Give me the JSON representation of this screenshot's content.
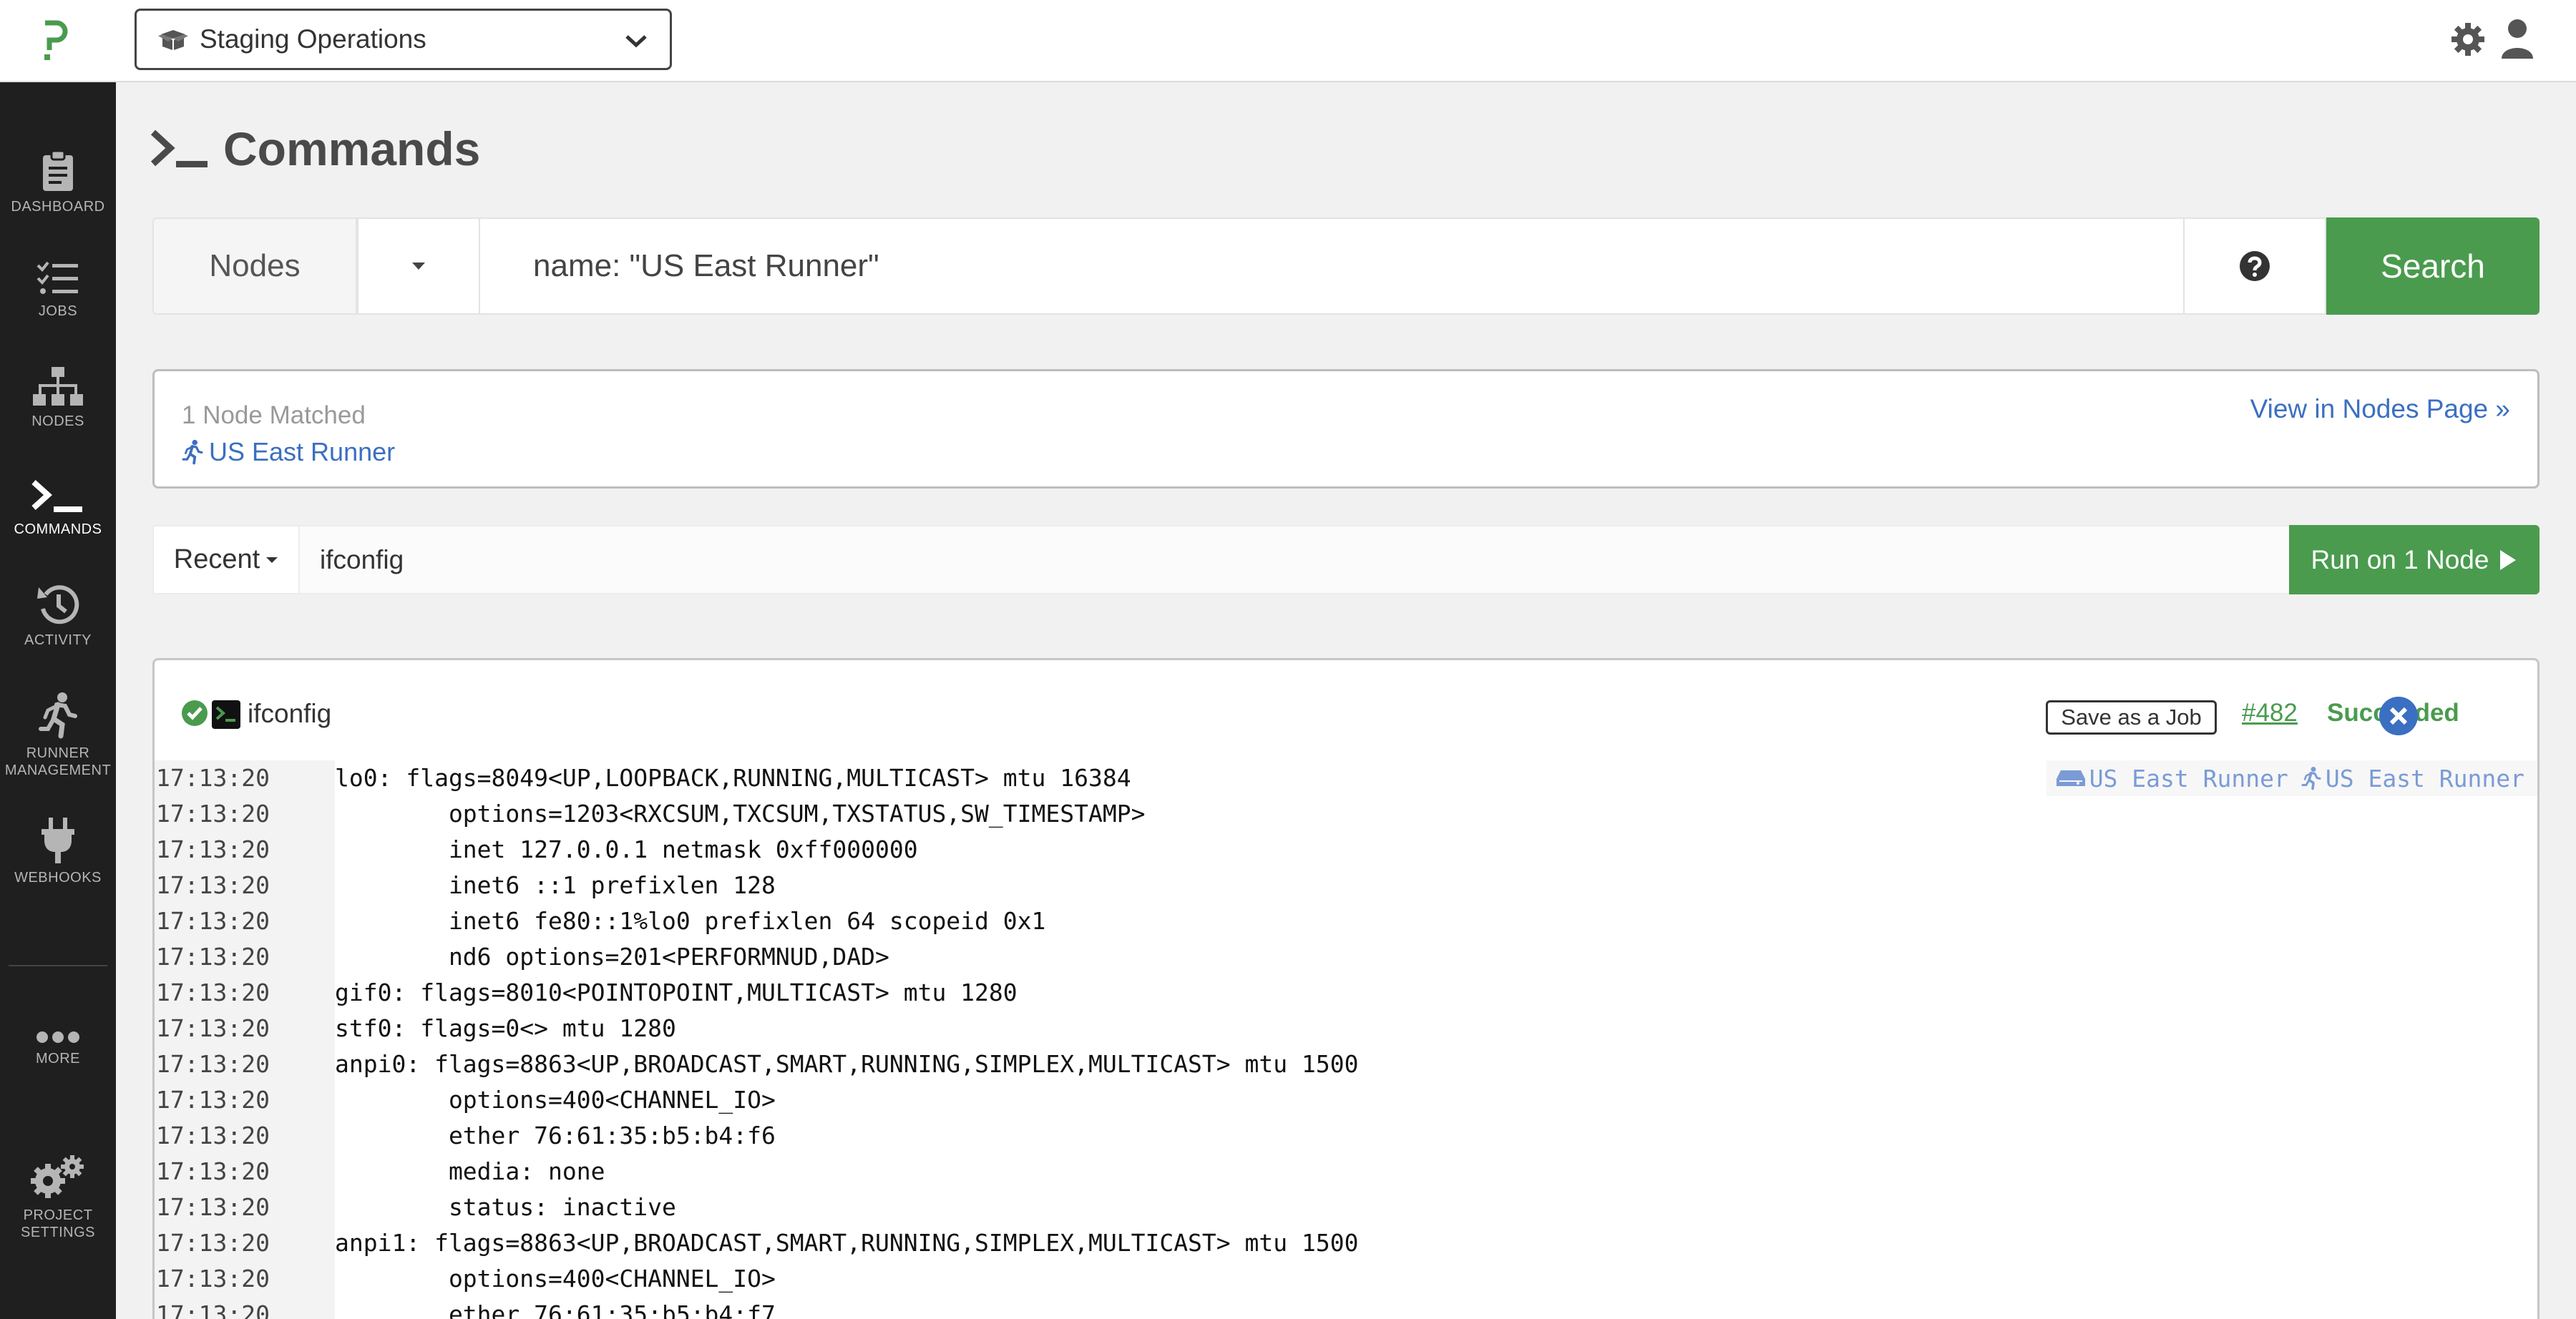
{
  "header": {
    "project_name": "Staging Operations"
  },
  "sidebar": {
    "items": [
      {
        "label": "DASHBOARD",
        "icon": "clipboard-icon"
      },
      {
        "label": "JOBS",
        "icon": "checklist-icon"
      },
      {
        "label": "NODES",
        "icon": "sitemap-icon"
      },
      {
        "label": "COMMANDS",
        "icon": "terminal-icon",
        "active": true
      },
      {
        "label": "ACTIVITY",
        "icon": "history-icon"
      },
      {
        "label": "RUNNER",
        "label2": "MANAGEMENT",
        "icon": "runner-icon"
      },
      {
        "label": "WEBHOOKS",
        "icon": "plug-icon"
      },
      {
        "label": "MORE",
        "icon": "ellipsis-icon"
      },
      {
        "label": "PROJECT",
        "label2": "SETTINGS",
        "icon": "gears-icon"
      }
    ]
  },
  "page": {
    "title": "Commands"
  },
  "filter": {
    "nodes_label": "Nodes",
    "query": "name: \"US East Runner\"",
    "search_label": "Search"
  },
  "match": {
    "count_text": "1 Node Matched",
    "node_name": "US East Runner",
    "view_link": "View in Nodes Page »"
  },
  "command": {
    "recent_label": "Recent",
    "value": "ifconfig",
    "run_label": "Run on 1 Node"
  },
  "output": {
    "command": "ifconfig",
    "save_job_label": "Save as a Job",
    "exec_id": "#482",
    "status": "Succeeded",
    "node_server": "US East Runner",
    "node_runner": "US East Runner",
    "lines": [
      {
        "time": "17:13:20",
        "text": "lo0: flags=8049<UP,LOOPBACK,RUNNING,MULTICAST> mtu 16384"
      },
      {
        "time": "17:13:20",
        "text": "        options=1203<RXCSUM,TXCSUM,TXSTATUS,SW_TIMESTAMP>"
      },
      {
        "time": "17:13:20",
        "text": "        inet 127.0.0.1 netmask 0xff000000"
      },
      {
        "time": "17:13:20",
        "text": "        inet6 ::1 prefixlen 128"
      },
      {
        "time": "17:13:20",
        "text": "        inet6 fe80::1%lo0 prefixlen 64 scopeid 0x1"
      },
      {
        "time": "17:13:20",
        "text": "        nd6 options=201<PERFORMNUD,DAD>"
      },
      {
        "time": "17:13:20",
        "text": "gif0: flags=8010<POINTOPOINT,MULTICAST> mtu 1280"
      },
      {
        "time": "17:13:20",
        "text": "stf0: flags=0<> mtu 1280"
      },
      {
        "time": "17:13:20",
        "text": "anpi0: flags=8863<UP,BROADCAST,SMART,RUNNING,SIMPLEX,MULTICAST> mtu 1500"
      },
      {
        "time": "17:13:20",
        "text": "        options=400<CHANNEL_IO>"
      },
      {
        "time": "17:13:20",
        "text": "        ether 76:61:35:b5:b4:f6"
      },
      {
        "time": "17:13:20",
        "text": "        media: none"
      },
      {
        "time": "17:13:20",
        "text": "        status: inactive"
      },
      {
        "time": "17:13:20",
        "text": "anpi1: flags=8863<UP,BROADCAST,SMART,RUNNING,SIMPLEX,MULTICAST> mtu 1500"
      },
      {
        "time": "17:13:20",
        "text": "        options=400<CHANNEL_IO>"
      },
      {
        "time": "17:13:20",
        "text": "        ether 76:61:35:b5:b4:f7"
      }
    ]
  },
  "colors": {
    "accent_green": "#4a9b4e",
    "link_blue": "#3b6fc2",
    "sidebar_bg": "#1f1f1f"
  }
}
